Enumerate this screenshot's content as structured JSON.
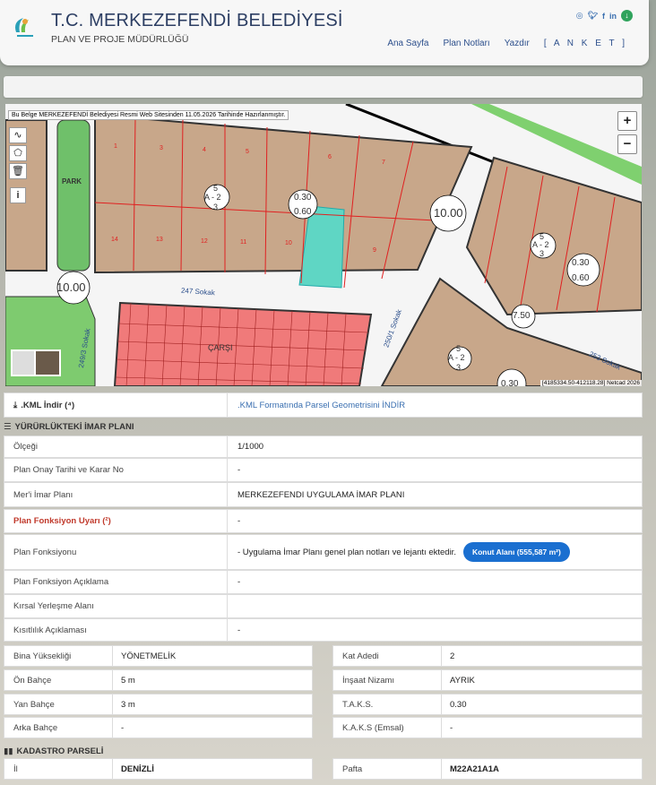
{
  "header": {
    "title": "T.C. MERKEZEFENDİ BELEDİYESİ",
    "subtitle": "PLAN VE PROJE MÜDÜRLÜĞÜ",
    "social_icons": [
      "instagram-icon",
      "twitter-icon",
      "facebook-icon",
      "linkedin-icon",
      "download-icon"
    ],
    "nav": [
      "Ana Sayfa",
      "Plan Notları",
      "Yazdır",
      "[ A N K E T ]"
    ]
  },
  "map": {
    "notice": "Bu Belge MERKEZEFENDİ Belediyesi Resmi Web Sitesinden 11.05.2026 Tarihinde Hazırlanmıştır.",
    "coordinates": "[4185334.50-412118.28] Netcad 2026",
    "zoom_in": "+",
    "zoom_out": "−",
    "labels": {
      "park": "PARK",
      "carsi": "ÇARŞI",
      "street_247": "247 Sokak",
      "street_250_1": "250/1 Sokak",
      "street_253": "253 Sokak",
      "street_249_3": "249/3 Sokak",
      "road_width_a": "10.00",
      "road_width_b": "10.00",
      "road_width_c": "10.00",
      "road_width_d": "7.50",
      "taks_1": "0.30",
      "kaks_1": "0.60",
      "taks_2": "0.30",
      "kaks_2": "0.60",
      "taks_3": "0.30",
      "zone_top": "5",
      "zone_mid": "A - 2",
      "zone_bottom": "3",
      "zone2_top": "5",
      "zone2_mid": "A - 2",
      "zone2_bottom": "3",
      "zone3_top": "5",
      "zone3_mid": "A - 2",
      "zone3_bottom": "3"
    },
    "parcels_top": [
      "1",
      "3",
      "4",
      "5",
      "6",
      "7"
    ],
    "parcels_bottom": [
      "14",
      "13",
      "12",
      "11",
      "10",
      "9"
    ],
    "colors": {
      "block": "#c8a78a",
      "selected": "#5fd6c4",
      "road": "#ffffff",
      "park": "#7fc97f",
      "market": "#f07a7a"
    }
  },
  "kml": {
    "label": ".KML İndir (⁴)",
    "link": ".KML Formatında Parsel Geometrisini İNDİR"
  },
  "imar": {
    "section_title": "YÜRÜRLÜKTEKİ İMAR PLANI",
    "rows": [
      {
        "label": "Ölçeği",
        "value": "1/1000"
      },
      {
        "label": "Plan Onay Tarihi ve Karar No",
        "value": "-"
      },
      {
        "label": "Mer'i İmar Planı",
        "value": "MERKEZEFENDI UYGULAMA İMAR PLANI"
      },
      {
        "label": "Plan Fonksiyon Uyarı (²)",
        "value": "-"
      },
      {
        "label": "Plan Fonksiyonu",
        "value": "- Uygulama İmar Planı genel plan notları ve lejantı ektedir."
      },
      {
        "label": "Plan Fonksiyon Açıklama",
        "value": "-"
      },
      {
        "label": "Kırsal Yerleşme Alanı",
        "value": ""
      },
      {
        "label": "Kısıtlılık Açıklaması",
        "value": "-"
      }
    ],
    "function_button": "Konut Alanı (555,587 m²)"
  },
  "details": {
    "left": [
      {
        "label": "Bina Yüksekliği",
        "value": "YÖNETMELİK"
      },
      {
        "label": "Ön Bahçe",
        "value": "5 m"
      },
      {
        "label": "Yan Bahçe",
        "value": "3 m"
      },
      {
        "label": "Arka Bahçe",
        "value": "-"
      }
    ],
    "right": [
      {
        "label": "Kat Adedi",
        "value": "2"
      },
      {
        "label": "İnşaat Nizamı",
        "value": "AYRIK"
      },
      {
        "label": "T.A.K.S.",
        "value": "0.30"
      },
      {
        "label": "K.A.K.S (Emsal)",
        "value": "-"
      }
    ]
  },
  "kadastro": {
    "section_title": "KADASTRO PARSELİ",
    "left": {
      "label": "İl",
      "value": "DENİZLİ"
    },
    "right": {
      "label": "Pafta",
      "value": "M22A21A1A"
    }
  }
}
